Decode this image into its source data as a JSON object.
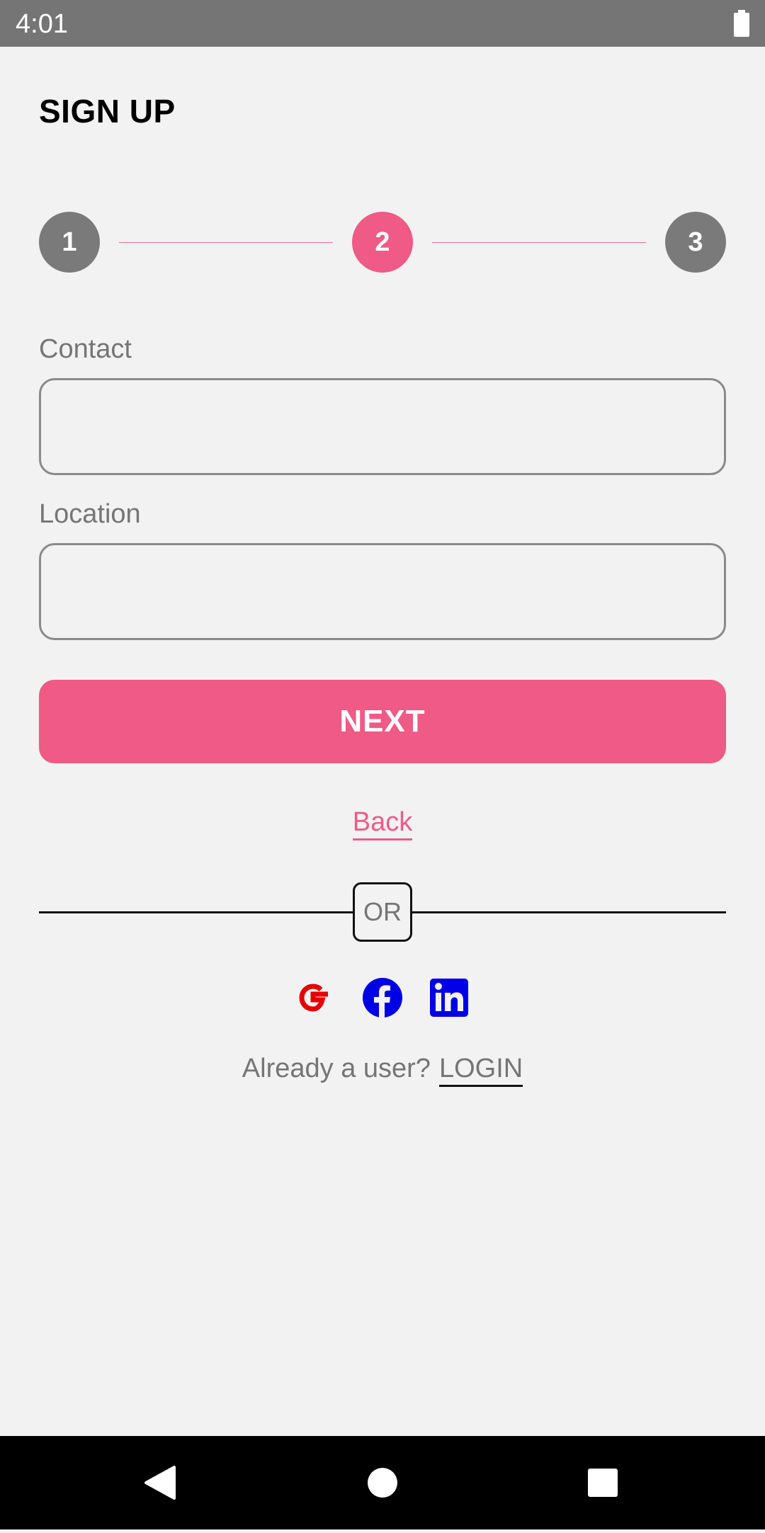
{
  "status_bar": {
    "time": "4:01",
    "battery_icon": "battery-full-icon"
  },
  "header": {
    "title": "SIGN UP"
  },
  "stepper": {
    "steps": [
      {
        "label": "1",
        "state": "inactive"
      },
      {
        "label": "2",
        "state": "active"
      },
      {
        "label": "3",
        "state": "inactive"
      }
    ],
    "active_color": "#ef5a87",
    "inactive_color": "#7a7a7a"
  },
  "form": {
    "contact": {
      "label": "Contact",
      "value": ""
    },
    "location": {
      "label": "Location",
      "value": ""
    },
    "next_label": "NEXT",
    "back_label": "Back"
  },
  "divider": {
    "label": "OR"
  },
  "social": [
    {
      "icon": "google-icon",
      "color": "#e60000"
    },
    {
      "icon": "facebook-icon",
      "color": "#0000e6"
    },
    {
      "icon": "linkedin-icon",
      "color": "#0000e6"
    }
  ],
  "footer": {
    "prompt": "Already a user?",
    "login_label": "LOGIN"
  },
  "nav_bar": {
    "icons": [
      "back-icon",
      "home-icon",
      "recents-icon"
    ]
  },
  "colors": {
    "accent": "#ef5a87",
    "background": "#f2f2f2",
    "status_bar": "#757575"
  }
}
